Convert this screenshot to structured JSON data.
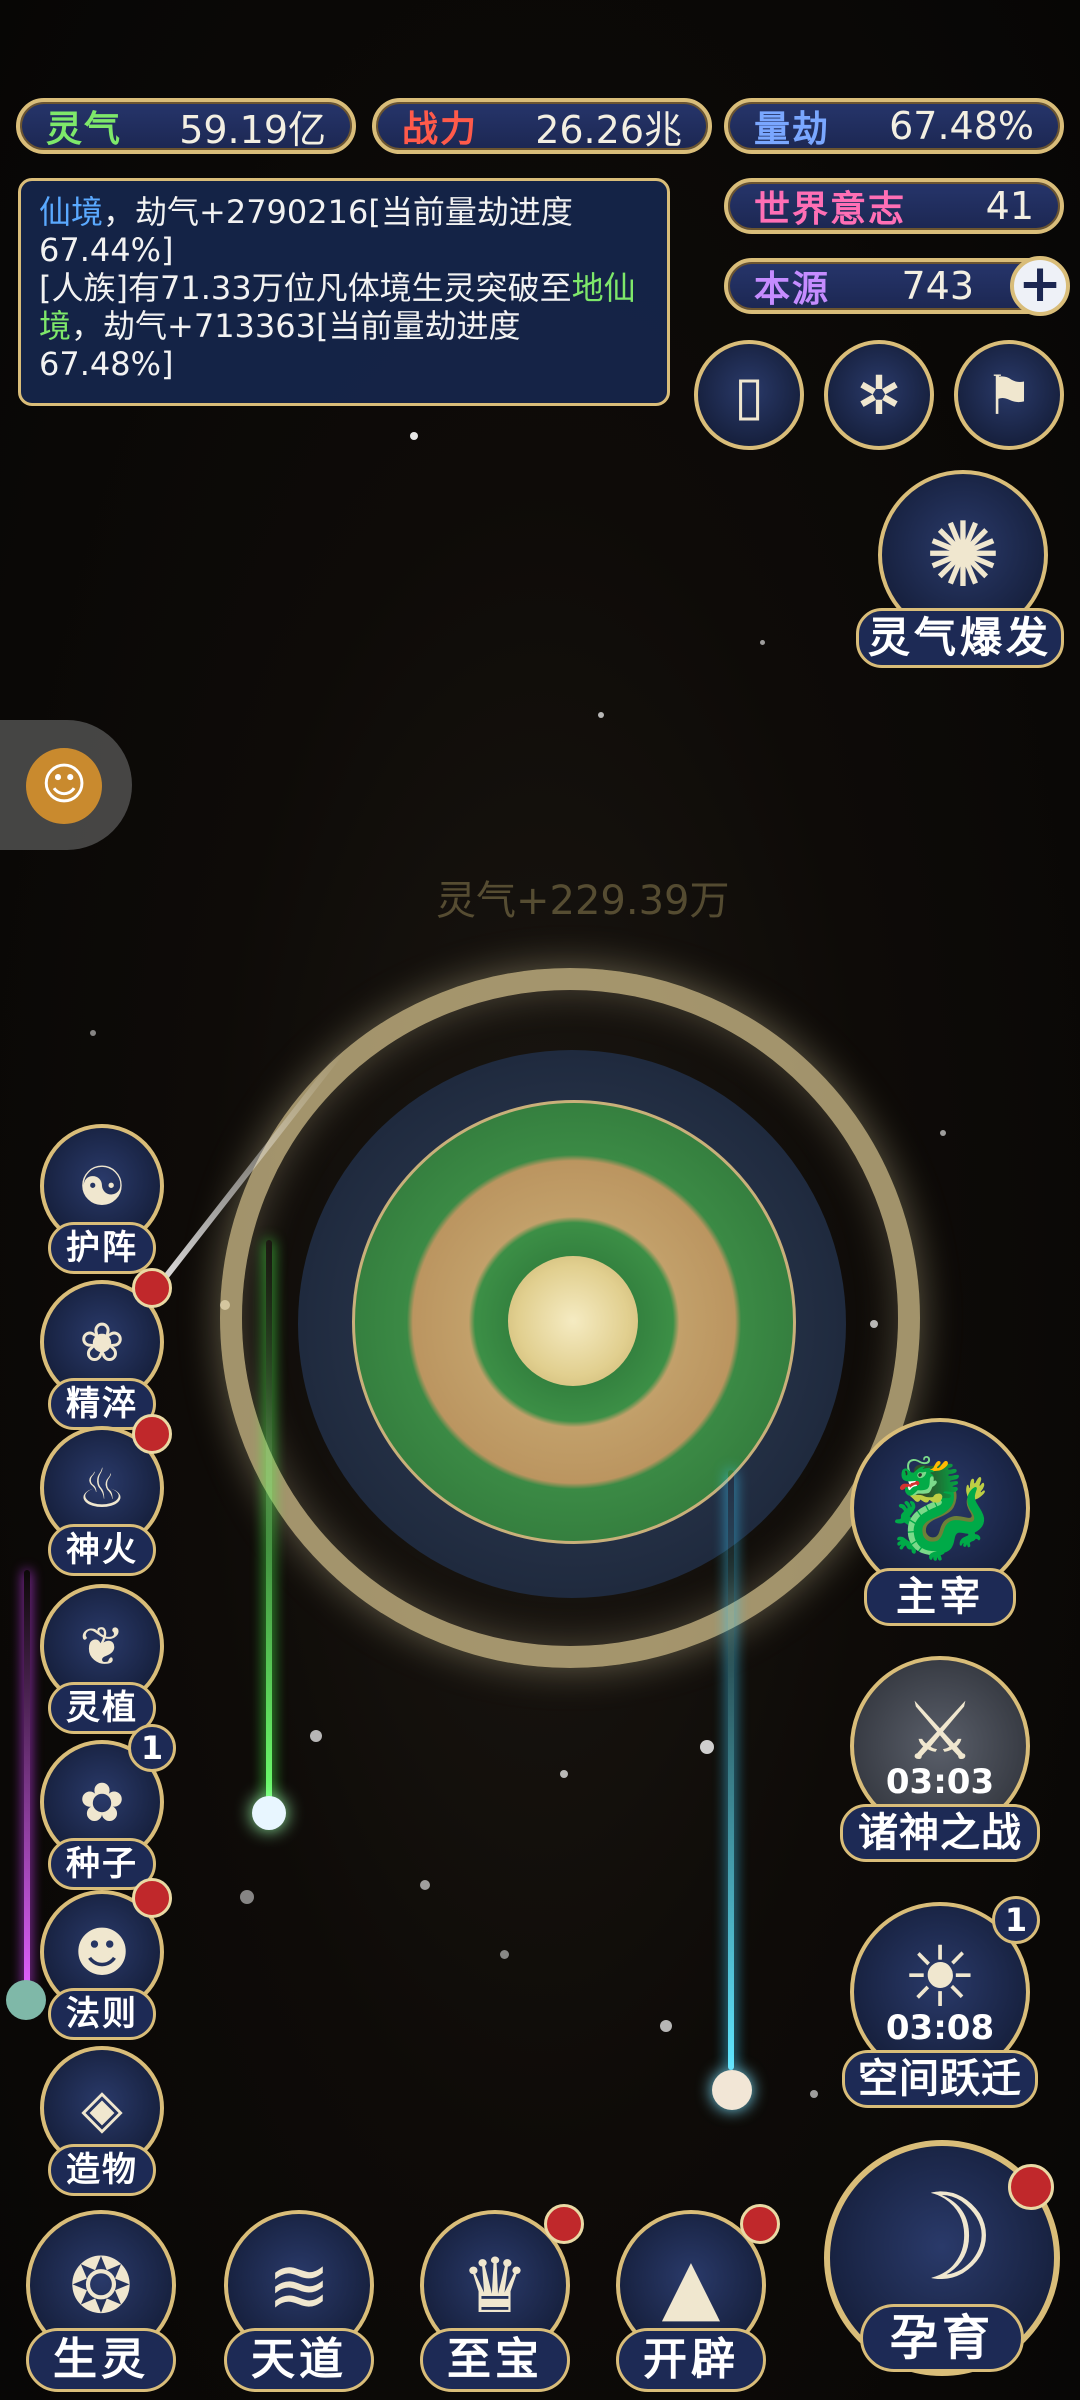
{
  "stats": {
    "lingqi": {
      "label": "灵气",
      "value": "59.19亿"
    },
    "zhanli": {
      "label": "战力",
      "value": "26.26兆"
    },
    "liangjie": {
      "label": "量劫",
      "value": "67.48%"
    },
    "shijie": {
      "label": "世界意志",
      "value": "41"
    },
    "benyuan": {
      "label": "本源",
      "value": "743"
    }
  },
  "log": {
    "line1_a": "仙境",
    "line1_b": "，劫气+2790216[当前量劫进度67.44%]",
    "line2_a": "[人族]有71.33万位凡体境生灵突破至",
    "line2_b": "地仙境",
    "line2_c": "，劫气+713363[当前量劫进度67.48%]"
  },
  "floating_text": "灵气+229.39万",
  "buttons": {
    "lingqi_baofa": "灵气爆发",
    "zhuzai": "主宰",
    "zhushen": "诸神之战",
    "zhushen_timer": "03:03",
    "kongjian": "空间跃迁",
    "kongjian_timer": "03:08",
    "kongjian_badge": "1",
    "yunyu": "孕育"
  },
  "side_menu": [
    {
      "label": "护阵"
    },
    {
      "label": "精淬"
    },
    {
      "label": "神火"
    },
    {
      "label": "灵植"
    },
    {
      "label": "种子",
      "badge": "1"
    },
    {
      "label": "法则"
    },
    {
      "label": "造物"
    }
  ],
  "bottom_bar": [
    {
      "label": "生灵"
    },
    {
      "label": "天道"
    },
    {
      "label": "至宝"
    },
    {
      "label": "开辟"
    }
  ],
  "colors": {
    "gold": "#d9bd79",
    "panel_blue": "#1c2752",
    "lingqi_label": "#7ee86a",
    "zhanli_label": "#ff5a4a",
    "liangjie_label": "#7aa7ff",
    "shijie_label": "#ff6fb5",
    "benyuan_label": "#c58cff"
  }
}
